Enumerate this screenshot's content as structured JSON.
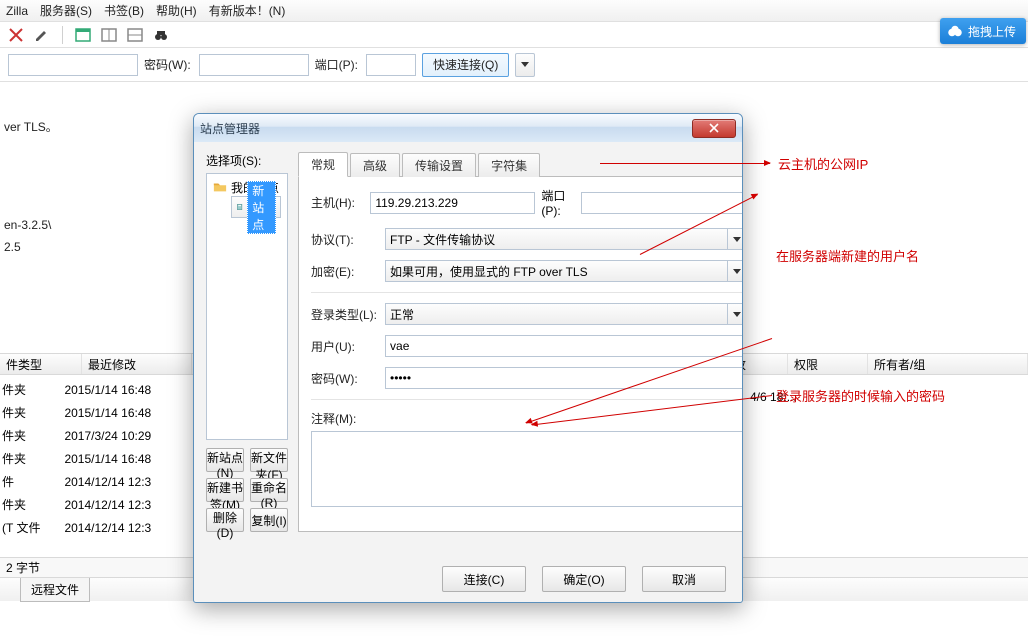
{
  "menubar": {
    "app_fragment": "Zilla",
    "items": [
      "服务器(S)",
      "书签(B)",
      "帮助(H)",
      "有新版本！(N)"
    ]
  },
  "drag_upload": "拖拽上传",
  "quickbar": {
    "pwd_label": "密码(W):",
    "port_label": "端口(P):",
    "quick_connect": "快速连接(Q)"
  },
  "bg": {
    "over_tls": "ver TLS。",
    "path_fragment": "en-3.2.5\\",
    "path2": "2.5",
    "thead_left": [
      "件类型",
      "最近修改"
    ],
    "thead_right": [
      "改",
      "权限",
      "所有者/组"
    ],
    "rows": [
      [
        "件夹",
        "2015/1/14 16:48"
      ],
      [
        "件夹",
        "2015/1/14 16:48"
      ],
      [
        "件夹",
        "2017/3/24 10:29"
      ],
      [
        "件夹",
        "2015/1/14 16:48"
      ],
      [
        "件",
        "2014/12/14 12:3"
      ],
      [
        "件夹",
        "2014/12/14 12:3"
      ],
      [
        "(T 文件",
        "2014/12/14 12:3"
      ]
    ],
    "right_row": "4/6 18:...",
    "bytes": "2 字节",
    "bottom_tab": "远程文件"
  },
  "dialog": {
    "title": "站点管理器",
    "select_label": "选择项(S):",
    "tree": {
      "root": "我的站点",
      "child": "新站点"
    },
    "buttons": {
      "new_site": "新站点(N)",
      "new_folder": "新文件夹(F)",
      "new_bookmark": "新建书签(M)",
      "rename": "重命名(R)",
      "delete": "删除(D)",
      "copy": "复制(I)"
    },
    "tabs": [
      "常规",
      "高级",
      "传输设置",
      "字符集"
    ],
    "active_tab": 0,
    "form": {
      "host_label": "主机(H):",
      "host": "119.29.213.229",
      "port_label": "端口(P):",
      "port": "",
      "protocol_label": "协议(T):",
      "protocol": "FTP - 文件传输协议",
      "encryption_label": "加密(E):",
      "encryption": "如果可用，使用显式的 FTP over TLS",
      "login_type_label": "登录类型(L):",
      "login_type": "正常",
      "user_label": "用户(U):",
      "user": "vae",
      "pwd_label": "密码(W):",
      "pwd": "•••••",
      "comment_label": "注释(M):"
    },
    "footer": {
      "connect": "连接(C)",
      "ok": "确定(O)",
      "cancel": "取消"
    }
  },
  "annotations": {
    "a1": "云主机的公网IP",
    "a2": "在服务器端新建的用户名",
    "a3": "登录服务器的时候输入的密码"
  }
}
